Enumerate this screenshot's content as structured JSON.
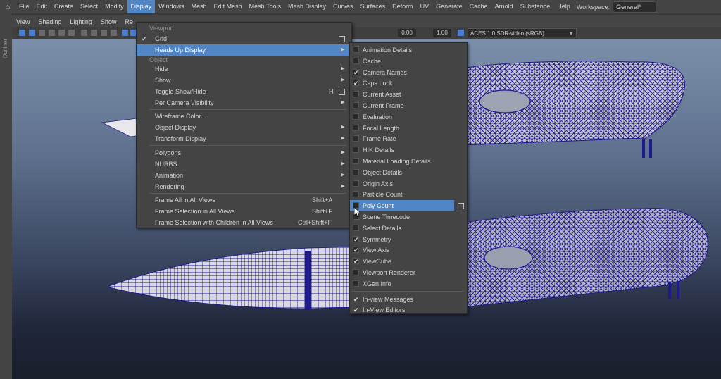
{
  "menubar": {
    "items": [
      "File",
      "Edit",
      "Create",
      "Select",
      "Modify",
      "Display",
      "Windows",
      "Mesh",
      "Edit Mesh",
      "Mesh Tools",
      "Mesh Display",
      "Curves",
      "Surfaces",
      "Deform",
      "UV",
      "Generate",
      "Cache",
      "Arnold",
      "Substance",
      "Help"
    ],
    "active": "Display",
    "workspace_label": "Workspace:",
    "workspace_value": "General*"
  },
  "outliner_label": "Outliner",
  "panel_menu": [
    "View",
    "Shading",
    "Lighting",
    "Show",
    "Re"
  ],
  "toolbar": {
    "field_1": "0.00",
    "field_2": "1.00",
    "color_space": "ACES 1.0 SDR-video (sRGB)"
  },
  "display_menu": {
    "section_viewport": "Viewport",
    "grid": "Grid",
    "heads_up_display": "Heads Up Display",
    "section_object": "Object",
    "hide": "Hide",
    "show": "Show",
    "toggle_show_hide": "Toggle Show/Hide",
    "toggle_shortcut": "H",
    "per_camera_visibility": "Per Camera Visibility",
    "wireframe_color": "Wireframe Color...",
    "object_display": "Object Display",
    "transform_display": "Transform Display",
    "polygons": "Polygons",
    "nurbs": "NURBS",
    "animation": "Animation",
    "rendering": "Rendering",
    "frame_all": "Frame All in All Views",
    "frame_all_shortcut": "Shift+A",
    "frame_selection": "Frame Selection in All Views",
    "frame_selection_shortcut": "Shift+F",
    "frame_selection_children": "Frame Selection with Children in All Views",
    "frame_selection_children_shortcut": "Ctrl+Shift+F"
  },
  "hud_menu": {
    "items": [
      {
        "label": "Animation Details",
        "checked": false
      },
      {
        "label": "Cache",
        "checked": false
      },
      {
        "label": "Camera Names",
        "checked": true
      },
      {
        "label": "Caps Lock",
        "checked": true
      },
      {
        "label": "Current Asset",
        "checked": false
      },
      {
        "label": "Current Frame",
        "checked": false
      },
      {
        "label": "Evaluation",
        "checked": false
      },
      {
        "label": "Focal Length",
        "checked": false
      },
      {
        "label": "Frame Rate",
        "checked": false
      },
      {
        "label": "HIK Details",
        "checked": false
      },
      {
        "label": "Material Loading Details",
        "checked": false
      },
      {
        "label": "Object Details",
        "checked": false
      },
      {
        "label": "Origin Axis",
        "checked": false
      },
      {
        "label": "Particle Count",
        "checked": false
      },
      {
        "label": "Poly Count",
        "checked": false,
        "highlighted": true
      },
      {
        "label": "Scene Timecode",
        "checked": false
      },
      {
        "label": "Select Details",
        "checked": false
      },
      {
        "label": "Symmetry",
        "checked": true
      },
      {
        "label": "View Axis",
        "checked": true
      },
      {
        "label": "ViewCube",
        "checked": true
      },
      {
        "label": "Viewport Renderer",
        "checked": false
      },
      {
        "label": "XGen Info",
        "checked": false
      }
    ],
    "bottom_items": [
      {
        "label": "In-view Messages",
        "checked": true
      },
      {
        "label": "In-View Editors",
        "checked": true
      }
    ]
  },
  "colors": {
    "highlight": "#5285c4",
    "wireframe": "#1e1a8c",
    "menu_bg": "#444444"
  }
}
